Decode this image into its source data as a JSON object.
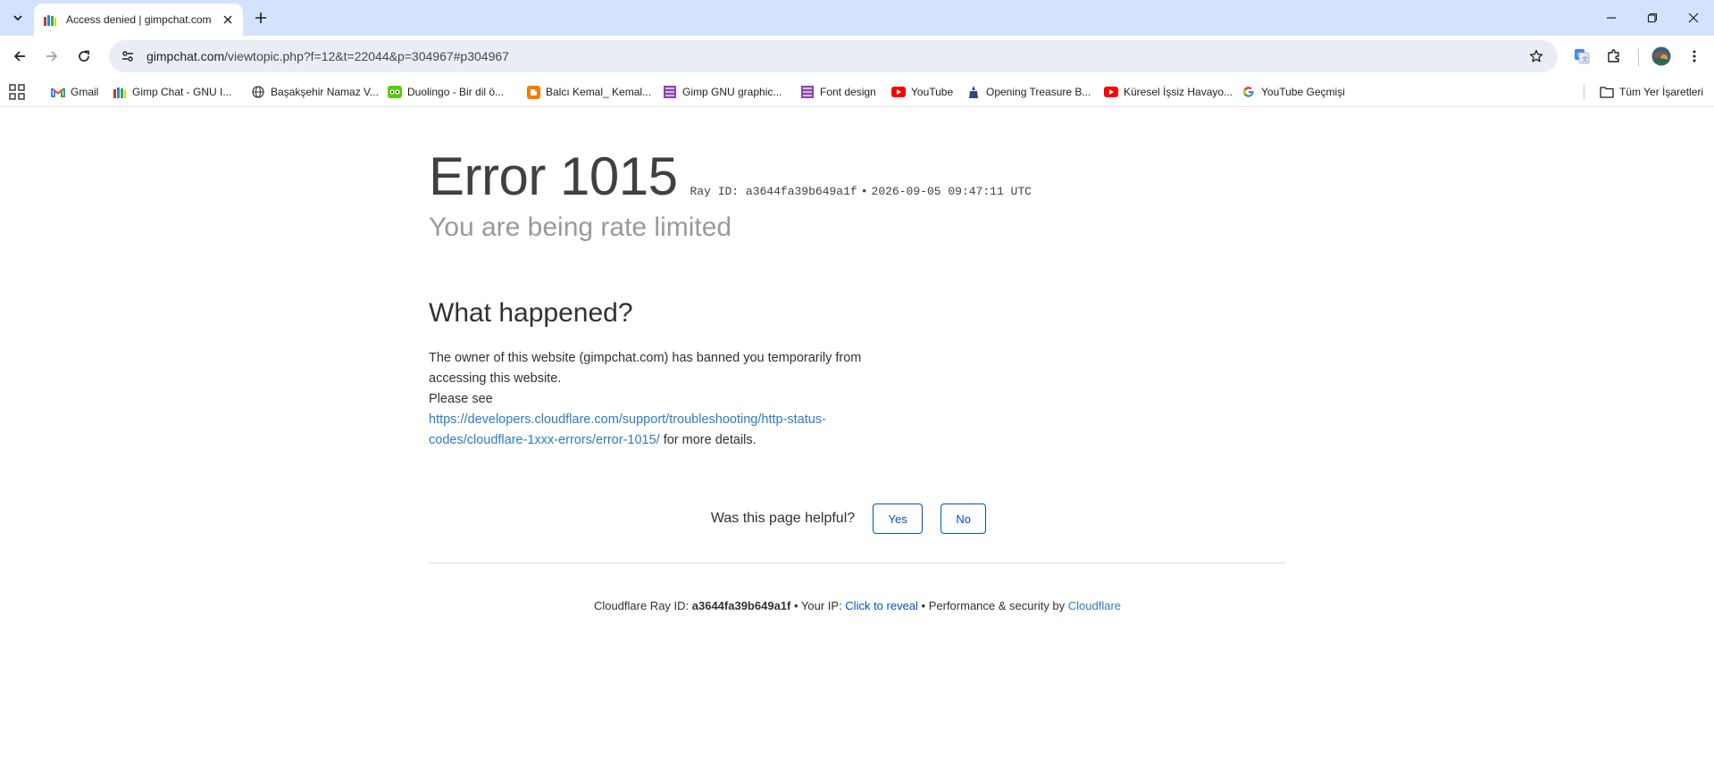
{
  "browser": {
    "tab": {
      "title": "Access denied | gimpchat.com"
    },
    "address": {
      "host": "gimpchat.com",
      "path": "/viewtopic.php?f=12&t=22044&p=304967#p304967"
    },
    "bookmarks": [
      {
        "label": "Gmail",
        "icon": "gmail-icon",
        "color": "#ea4335"
      },
      {
        "label": "Gimp Chat - GNU I...",
        "icon": "gimp-chat-icon",
        "color": "#7b4a2a"
      },
      {
        "label": "Başakşehir Namaz V...",
        "icon": "globe-icon",
        "color": "#555555"
      },
      {
        "label": "Duolingo - Bir dil ö...",
        "icon": "duolingo-icon",
        "color": "#58cc02"
      },
      {
        "label": "Balcı Kemal_ Kemal...",
        "icon": "blogger-icon",
        "color": "#f57d00"
      },
      {
        "label": "Gimp GNU graphic...",
        "icon": "gimp-icon",
        "color": "#8e44ad"
      },
      {
        "label": "Font design",
        "icon": "font-design-icon",
        "color": "#8e44ad"
      },
      {
        "label": "YouTube",
        "icon": "youtube-icon",
        "color": "#ff0000"
      },
      {
        "label": "Opening Treasure B...",
        "icon": "treasure-icon",
        "color": "#2c4a7a"
      },
      {
        "label": "Küresel İşsiz Havayo...",
        "icon": "youtube-icon",
        "color": "#ff0000"
      },
      {
        "label": "YouTube Geçmişi",
        "icon": "google-icon",
        "color": "#4285f4"
      }
    ],
    "all_bookmarks": "Tüm Yer İşaretleri"
  },
  "page": {
    "error_code": "Error 1015",
    "ray_label": "Ray ID: a3644fa39b649a1f",
    "bullet": "•",
    "timestamp": "2026-09-05 09:47:11 UTC",
    "subtitle": "You are being rate limited",
    "what_heading": "What happened?",
    "explain_1": "The owner of this website (gimpchat.com) has banned you temporarily from accessing this website.",
    "explain_2": "Please see",
    "explain_link": "https://developers.cloudflare.com/support/troubleshooting/http-status-codes/cloudflare-1xxx-errors/error-1015/",
    "explain_3": " for more details.",
    "feedback_question": "Was this page helpful?",
    "feedback_yes": "Yes",
    "feedback_no": "No",
    "footer": {
      "ray_label": "Cloudflare Ray ID: ",
      "ray_id": "a3644fa39b649a1f",
      "sep": " • ",
      "ip_label": "Your IP: ",
      "ip_link": "Click to reveal",
      "perf_label": "Performance & security by ",
      "cf_link": "Cloudflare"
    }
  },
  "colors": {
    "link": "#2f7bbf",
    "cf_blue": "#0051c3",
    "tabstrip": "#d3e3fd"
  }
}
